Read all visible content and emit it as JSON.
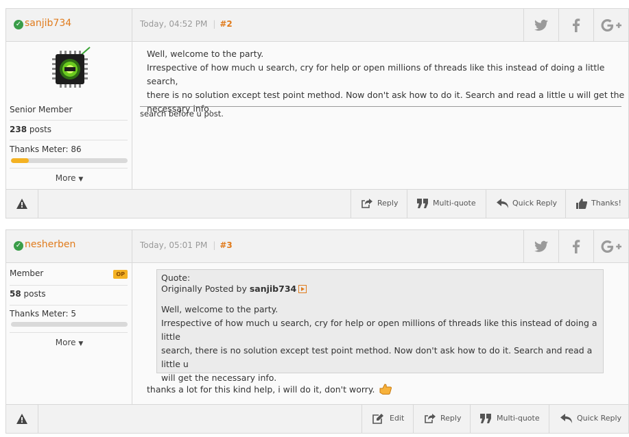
{
  "posts": [
    {
      "author": "sanjib734",
      "date": "Today, 04:52 PM",
      "separator": "|",
      "number": "#2",
      "rank": "Senior Member",
      "posts_count": "238",
      "posts_suffix": " posts",
      "thanks_meter": "Thanks Meter: 86",
      "thanks_fraction": 0.15,
      "more": "More",
      "body": [
        "Well, welcome to the party.",
        "Irrespective of how much u search, cry for help or open millions of threads like this instead of doing a little search,",
        "there is no solution except test point method. Now don't ask how to do it. Search and read a little u will get the",
        "necessary info."
      ],
      "signature": "search before u post.",
      "actions": [
        "Reply",
        "Multi-quote",
        "Quick Reply",
        "Thanks!"
      ]
    },
    {
      "author": "nesherben",
      "date": "Today, 05:01 PM",
      "separator": "|",
      "number": "#3",
      "rank": "Member",
      "op_badge": "OP",
      "posts_count": "58",
      "posts_suffix": " posts",
      "thanks_meter": "Thanks Meter: 5",
      "thanks_fraction": 0.0,
      "more": "More",
      "quote": {
        "label": "Quote:",
        "posted_by": "Originally Posted by ",
        "author": "sanjib734",
        "lines": [
          "Well, welcome to the party.",
          "Irrespective of how much u search, cry for help or open millions of threads like this instead of doing a little",
          "search, there is no solution except test point method. Now don't ask how to do it. Search and read a little u",
          "will get the necessary info."
        ]
      },
      "body": "thanks a lot for this kind help, i will do it, don't worry.",
      "actions": [
        "Edit",
        "Reply",
        "Multi-quote",
        "Quick Reply"
      ]
    }
  ],
  "colors": {
    "accent": "#e07b1c",
    "online": "#3a9d49",
    "meter": "#f4b223"
  },
  "icons": [
    "online-check-icon",
    "twitter-icon",
    "facebook-icon",
    "google-plus-icon",
    "warning-icon",
    "reply-icon",
    "multi-quote-icon",
    "quick-reply-icon",
    "thanks-icon",
    "edit-icon",
    "view-post-icon",
    "thumbs-up-emoji-icon"
  ]
}
